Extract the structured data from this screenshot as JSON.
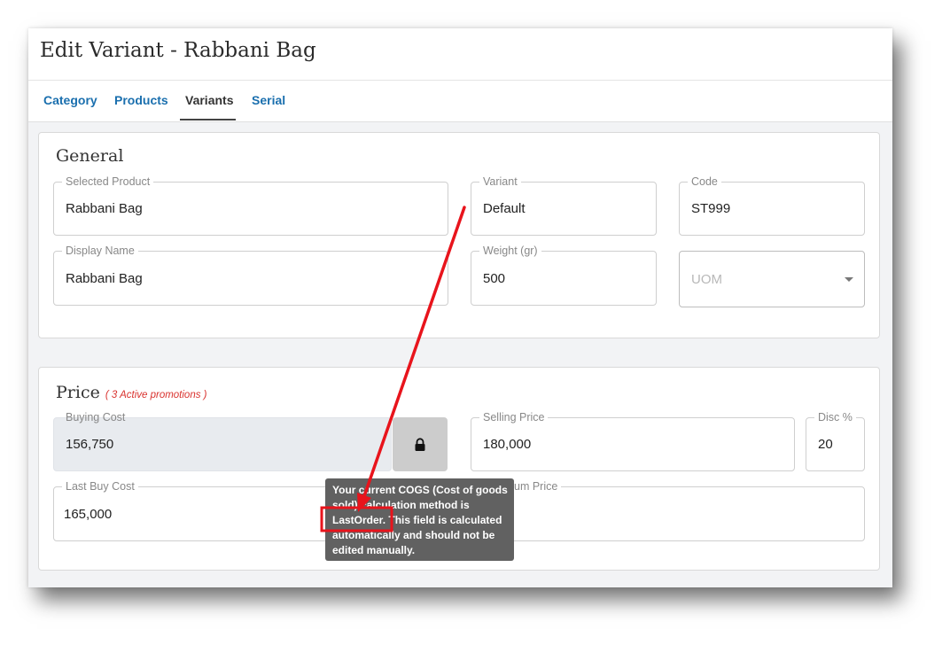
{
  "page": {
    "title": "Edit Variant - Rabbani Bag"
  },
  "tabs": [
    {
      "label": "Category"
    },
    {
      "label": "Products"
    },
    {
      "label": "Variants"
    },
    {
      "label": "Serial"
    }
  ],
  "active_tab": "Variants",
  "general": {
    "title": "General",
    "selected_product": {
      "label": "Selected Product",
      "value": "Rabbani Bag"
    },
    "variant": {
      "label": "Variant",
      "value": "Default"
    },
    "code": {
      "label": "Code",
      "value": "ST999"
    },
    "display_name": {
      "label": "Display Name",
      "value": "Rabbani Bag"
    },
    "weight": {
      "label": "Weight (gr)",
      "value": "500"
    },
    "uom": {
      "placeholder": "UOM"
    }
  },
  "price": {
    "title": "Price",
    "promotions": "( 3 Active promotions )",
    "buying_cost": {
      "label": "Buying Cost",
      "value": "156,750"
    },
    "selling_price": {
      "label": "Selling Price",
      "value": "180,000"
    },
    "disc": {
      "label": "Disc %",
      "value": "20"
    },
    "last_buy_cost": {
      "label": "Last Buy Cost",
      "value": "165,000"
    },
    "minimum_price": {
      "label_visible_part": "um Price"
    }
  },
  "tooltip": {
    "line1": "Your current COGS (Cost of goods",
    "line2": "sold) calculation method is",
    "method": "LastOrder.",
    "line3_rest": " This field is calculated",
    "line4": "automatically and should not be",
    "line5": "edited manually."
  },
  "icons": {
    "lock": "lock-icon",
    "dropdown": "chevron-down-icon"
  },
  "colors": {
    "tab_link": "#1a6fae",
    "promo": "#d9322e",
    "annotation": "#e8141c",
    "tooltip_bg": "#616161"
  }
}
